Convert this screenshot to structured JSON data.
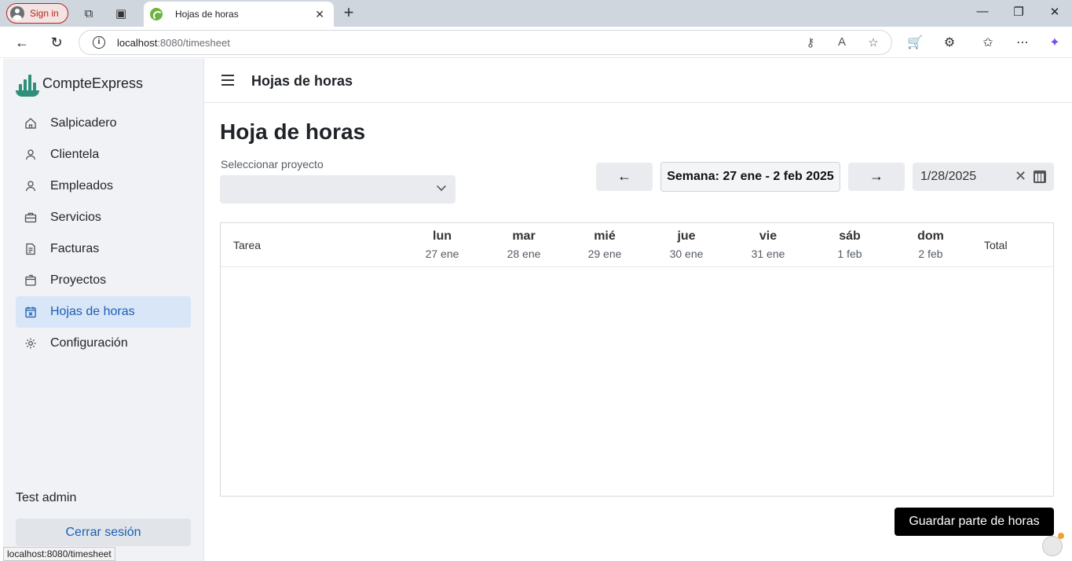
{
  "browser": {
    "signin_label": "Sign in",
    "tab_title": "Hojas de horas",
    "url_host": "localhost",
    "url_rest": ":8080/timesheet",
    "status_url": "localhost:8080/timesheet"
  },
  "app": {
    "brand": "CompteExpress",
    "page_title": "Hojas de horas",
    "menu": [
      {
        "label": "Salpicadero",
        "icon": "home-icon"
      },
      {
        "label": "Clientela",
        "icon": "person-icon"
      },
      {
        "label": "Empleados",
        "icon": "person-icon"
      },
      {
        "label": "Servicios",
        "icon": "briefcase-icon"
      },
      {
        "label": "Facturas",
        "icon": "document-icon"
      },
      {
        "label": "Proyectos",
        "icon": "folder-icon"
      },
      {
        "label": "Hojas de horas",
        "icon": "calendar-icon",
        "active": true
      },
      {
        "label": "Configuración",
        "icon": "gear-icon"
      }
    ],
    "user_name": "Test admin",
    "logout_label": "Cerrar sesión"
  },
  "timesheet": {
    "heading": "Hoja de horas",
    "project_label": "Seleccionar proyecto",
    "project_value": "",
    "prev_label": "←",
    "next_label": "→",
    "week_label": "Semana: 27 ene - 2 feb 2025",
    "date_value": "1/28/2025",
    "columns": {
      "task": "Tarea",
      "total": "Total",
      "days": [
        {
          "name": "lun",
          "date": "27 ene"
        },
        {
          "name": "mar",
          "date": "28 ene"
        },
        {
          "name": "mié",
          "date": "29 ene"
        },
        {
          "name": "jue",
          "date": "30 ene"
        },
        {
          "name": "vie",
          "date": "31 ene"
        },
        {
          "name": "sáb",
          "date": "1 feb"
        },
        {
          "name": "dom",
          "date": "2 feb"
        }
      ]
    },
    "rows": [],
    "save_label": "Guardar parte de horas"
  },
  "colors": {
    "accent": "#1a5fb4",
    "active_bg": "#d9e6f7",
    "sidebar_bg": "#f0f2f5",
    "save_bg": "#000000"
  }
}
